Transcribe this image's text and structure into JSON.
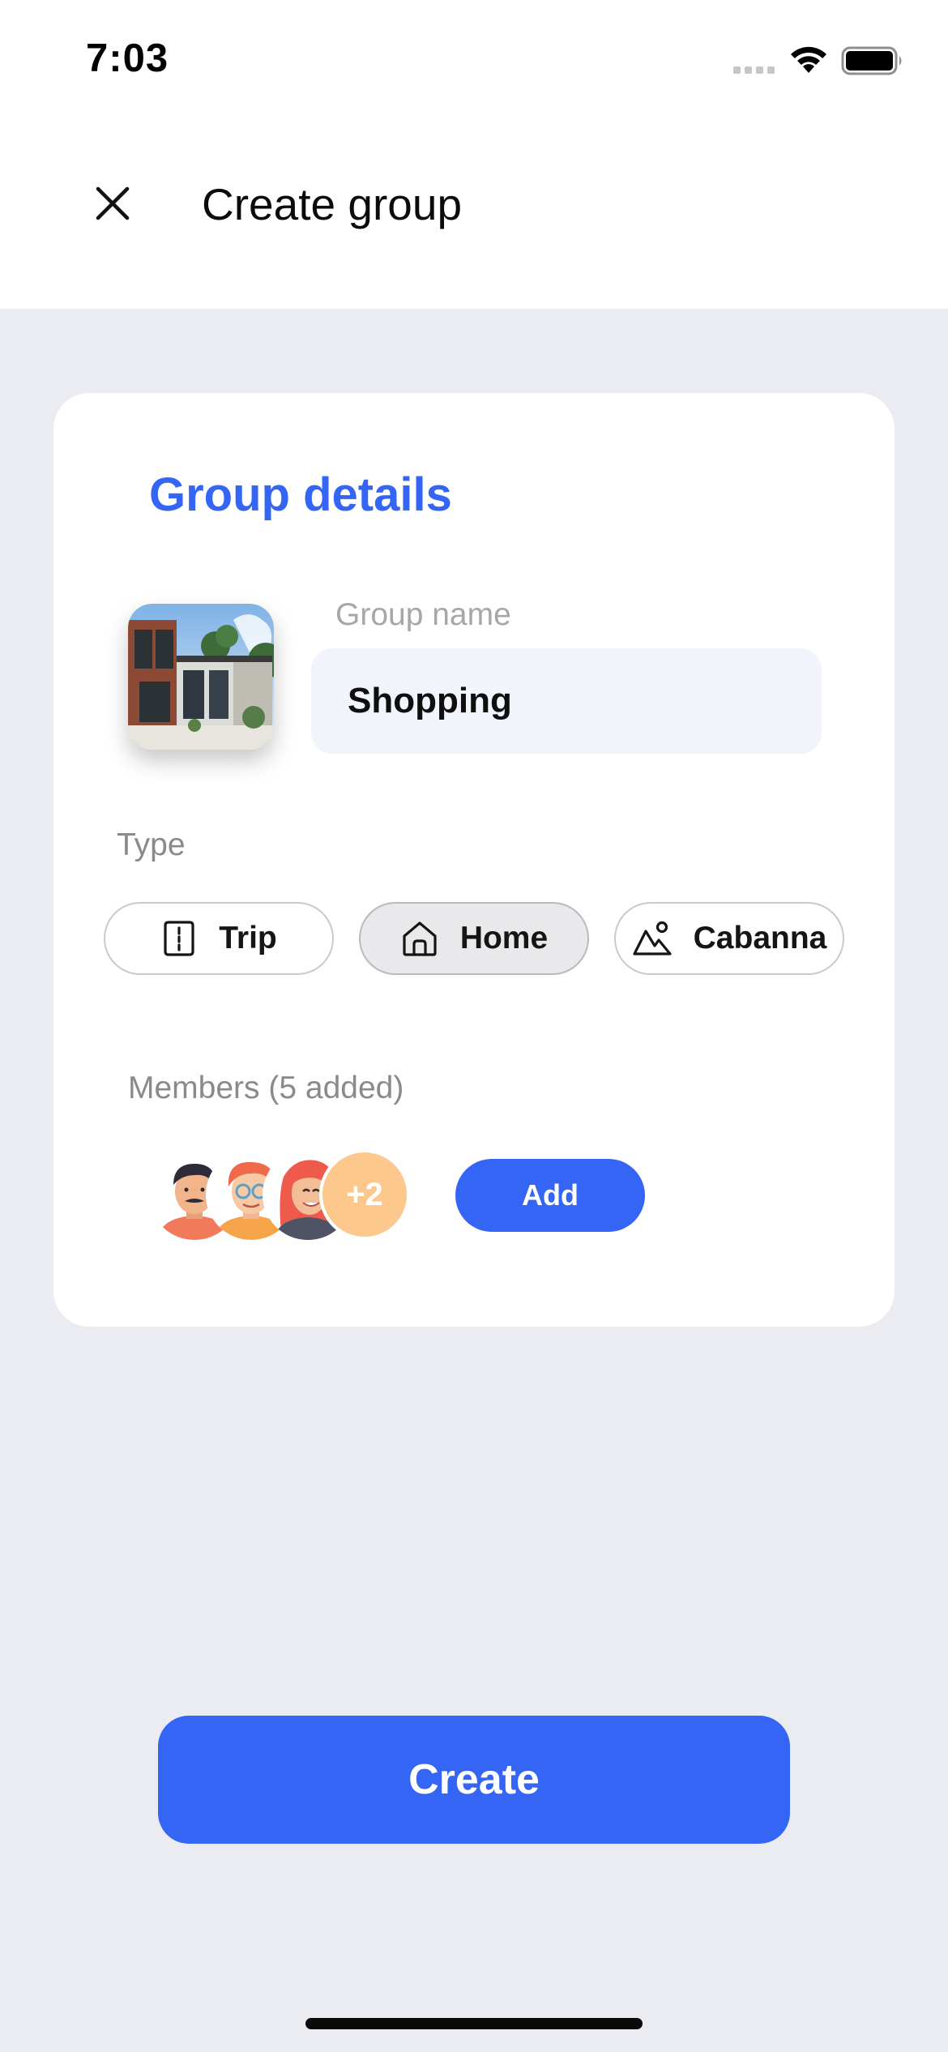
{
  "status_bar": {
    "time": "7:03",
    "signal_icon": "cellular-signal-icon",
    "wifi_icon": "wifi-icon",
    "battery_icon": "battery-icon"
  },
  "header": {
    "close_icon": "close-icon",
    "title": "Create group"
  },
  "card": {
    "section_title": "Group details",
    "group_photo": "house-photo",
    "group_name": {
      "label": "Group name",
      "value": "Shopping"
    },
    "type": {
      "label": "Type",
      "options": [
        {
          "label": "Trip",
          "icon": "road-icon",
          "selected": false
        },
        {
          "label": "Home",
          "icon": "home-icon",
          "selected": true
        },
        {
          "label": "Cabanna",
          "icon": "mountain-icon",
          "selected": false
        }
      ]
    },
    "members": {
      "label": "Members (5 added)",
      "more_count": "+2",
      "add_label": "Add"
    }
  },
  "footer": {
    "create_label": "Create"
  },
  "colors": {
    "accent": "#3465f5",
    "background": "#ebecf2",
    "input_bg": "#f1f4fb",
    "badge": "#fcc88b"
  }
}
